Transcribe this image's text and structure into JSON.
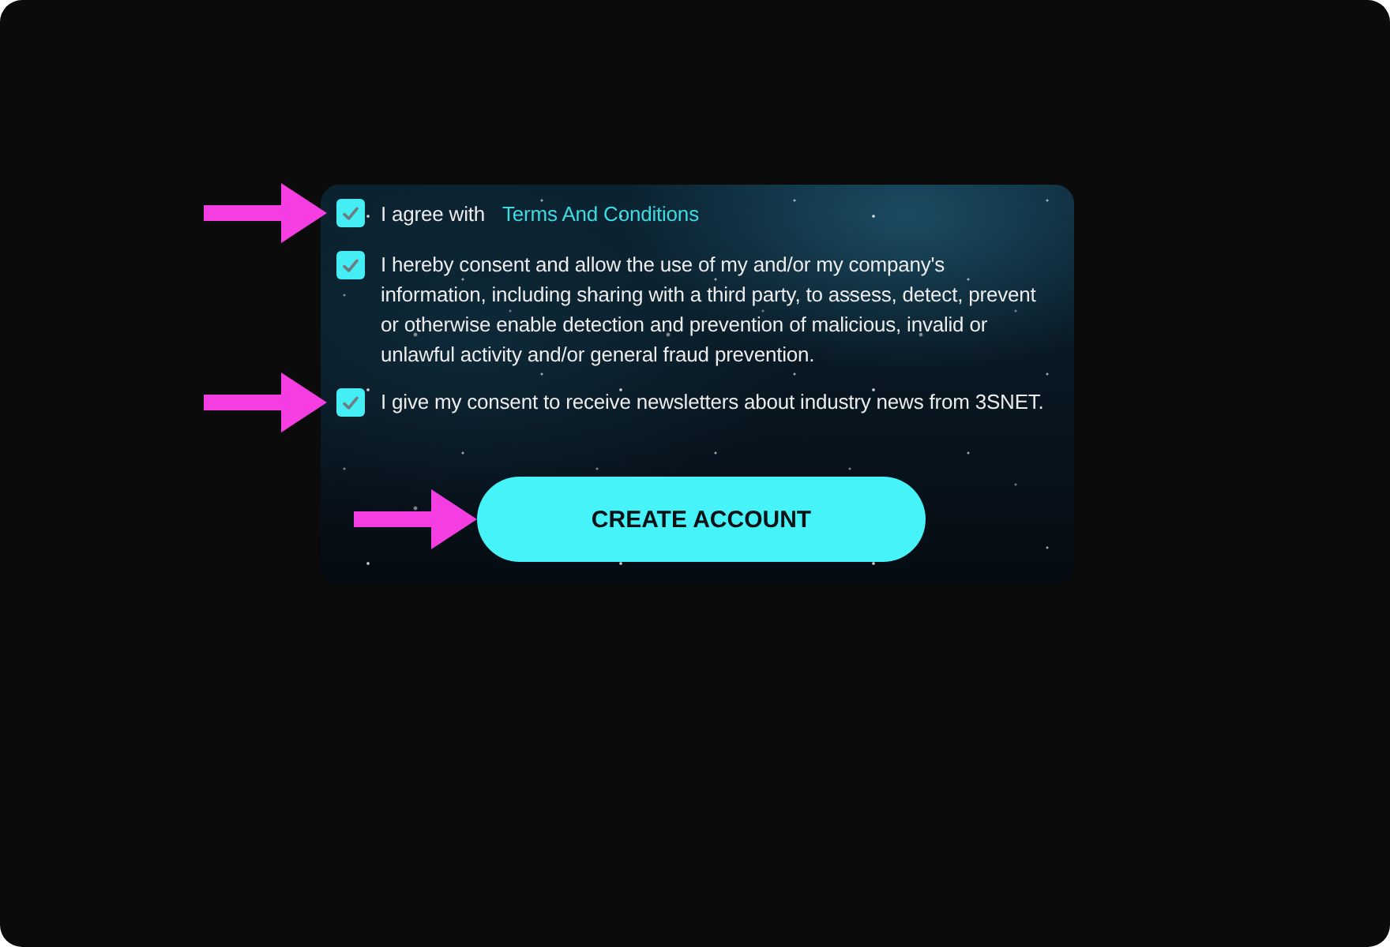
{
  "consents": [
    {
      "kind": "agreement",
      "text": "I agree with",
      "link": "Terms And Conditions",
      "checked": true,
      "marked": true
    },
    {
      "kind": "statement",
      "text": "I hereby consent and allow the use of my and/or my company's information, including sharing with a third party, to assess, detect, prevent or otherwise enable detection and prevention of malicious, invalid or unlawful activity and/or general fraud prevention.",
      "checked": true,
      "marked": false
    },
    {
      "kind": "statement",
      "text": "I give my consent to receive newsletters about industry news from 3SNET.",
      "checked": true,
      "marked": true
    }
  ],
  "create_account_button": {
    "label": "CREATE ACCOUNT",
    "marked": true
  }
}
